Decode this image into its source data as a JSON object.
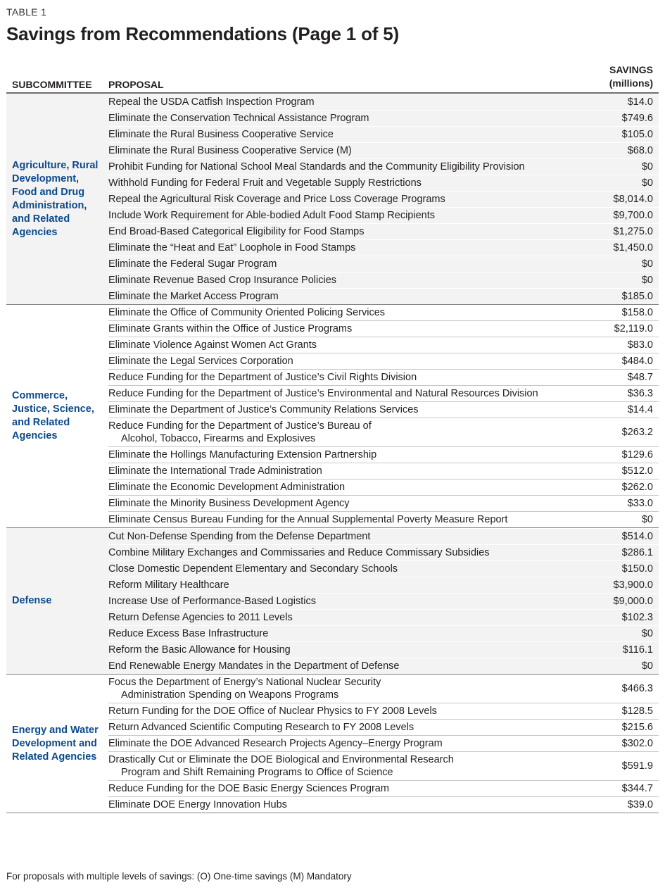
{
  "eyebrow": "TABLE 1",
  "title": "Savings from Recommendations (Page 1 of 5)",
  "columns": {
    "subcommittee": "SUBCOMMITTEE",
    "proposal": "PROPOSAL",
    "savings_line1": "SAVINGS",
    "savings_line2": "(millions)"
  },
  "colors": {
    "subcommittee_label": "#0b4a8b",
    "shaded_bg": "#f3f3f3"
  },
  "sections": [
    {
      "subcommittee": "Agriculture, Rural Development, Food and Drug Administration, and Related Agencies",
      "shaded": true,
      "rows": [
        {
          "proposal": "Repeal the USDA Catfish Inspection Program",
          "savings": "$14.0"
        },
        {
          "proposal": "Eliminate the Conservation Technical Assistance Program",
          "savings": "$749.6"
        },
        {
          "proposal": "Eliminate the Rural Business Cooperative Service",
          "savings": "$105.0"
        },
        {
          "proposal": "Eliminate the Rural Business Cooperative Service (M)",
          "savings": "$68.0"
        },
        {
          "proposal": "Prohibit Funding for National School Meal Standards and the Community Eligibility Provision",
          "savings": "$0"
        },
        {
          "proposal": "Withhold Funding for Federal Fruit and Vegetable Supply Restrictions",
          "savings": "$0"
        },
        {
          "proposal": "Repeal the Agricultural Risk Coverage and Price Loss Coverage Programs",
          "savings": "$8,014.0"
        },
        {
          "proposal": "Include Work Requirement for Able-bodied Adult Food Stamp Recipients",
          "savings": "$9,700.0"
        },
        {
          "proposal": "End Broad-Based Categorical Eligibility for Food Stamps",
          "savings": "$1,275.0"
        },
        {
          "proposal": "Eliminate the “Heat and Eat” Loophole in Food Stamps",
          "savings": "$1,450.0"
        },
        {
          "proposal": "Eliminate the Federal Sugar Program",
          "savings": "$0"
        },
        {
          "proposal": "Eliminate Revenue Based Crop Insurance Policies",
          "savings": "$0"
        },
        {
          "proposal": "Eliminate the Market Access Program",
          "savings": "$185.0"
        }
      ]
    },
    {
      "subcommittee": "Commerce, Justice, Science, and Related Agencies",
      "shaded": false,
      "rows": [
        {
          "proposal": "Eliminate the Office of Community Oriented Policing Services",
          "savings": "$158.0"
        },
        {
          "proposal": "Eliminate Grants within the Office of Justice Programs",
          "savings": "$2,119.0"
        },
        {
          "proposal": "Eliminate Violence Against Women Act Grants",
          "savings": "$83.0"
        },
        {
          "proposal": "Eliminate the Legal Services Corporation",
          "savings": "$484.0"
        },
        {
          "proposal": "Reduce Funding for the Department of Justice’s Civil Rights Division",
          "savings": "$48.7"
        },
        {
          "proposal": "Reduce Funding for the Department of Justice’s Environmental and Natural Resources Division",
          "savings": "$36.3"
        },
        {
          "proposal": "Eliminate the Department of Justice’s Community Relations Services",
          "savings": "$14.4"
        },
        {
          "proposal": "Reduce Funding for the Department of Justice’s Bureau of",
          "proposal_cont": "Alcohol, Tobacco, Firearms and Explosives",
          "savings": "$263.2"
        },
        {
          "proposal": "Eliminate the Hollings Manufacturing Extension Partnership",
          "savings": "$129.6"
        },
        {
          "proposal": "Eliminate the International Trade Administration",
          "savings": "$512.0"
        },
        {
          "proposal": "Eliminate the Economic Development Administration",
          "savings": "$262.0"
        },
        {
          "proposal": "Eliminate the Minority Business Development Agency",
          "savings": "$33.0"
        },
        {
          "proposal": "Eliminate Census Bureau Funding for the Annual Supplemental Poverty Measure Report",
          "savings": "$0"
        }
      ]
    },
    {
      "subcommittee": "Defense",
      "shaded": true,
      "rows": [
        {
          "proposal": "Cut Non-Defense Spending from the Defense Department",
          "savings": "$514.0"
        },
        {
          "proposal": "Combine Military Exchanges and Commissaries and Reduce Commissary Subsidies",
          "savings": "$286.1"
        },
        {
          "proposal": "Close Domestic Dependent Elementary and Secondary Schools",
          "savings": "$150.0"
        },
        {
          "proposal": "Reform Military Healthcare",
          "savings": "$3,900.0"
        },
        {
          "proposal": "Increase Use of Performance-Based Logistics",
          "savings": "$9,000.0"
        },
        {
          "proposal": "Return Defense Agencies to 2011 Levels",
          "savings": "$102.3"
        },
        {
          "proposal": "Reduce Excess Base Infrastructure",
          "savings": "$0"
        },
        {
          "proposal": "Reform the Basic Allowance for Housing",
          "savings": "$116.1"
        },
        {
          "proposal": "End Renewable Energy Mandates in the Department of Defense",
          "savings": "$0"
        }
      ]
    },
    {
      "subcommittee": "Energy and Water Development and Related Agencies",
      "shaded": false,
      "rows": [
        {
          "proposal": "Focus the Department of Energy’s National Nuclear Security",
          "proposal_cont": "Administration Spending on Weapons Programs",
          "savings": "$466.3"
        },
        {
          "proposal": "Return Funding for the DOE Office of Nuclear Physics to FY 2008 Levels",
          "savings": "$128.5"
        },
        {
          "proposal": "Return Advanced Scientific Computing Research to FY 2008 Levels",
          "savings": "$215.6"
        },
        {
          "proposal": "Eliminate the DOE Advanced Research Projects Agency–Energy Program",
          "savings": "$302.0"
        },
        {
          "proposal": "Drastically Cut or Eliminate the DOE Biological and Environmental Research",
          "proposal_cont": "Program and Shift Remaining Programs to Office of Science",
          "savings": "$591.9"
        },
        {
          "proposal": "Reduce Funding for the DOE Basic Energy Sciences Program",
          "savings": "$344.7"
        },
        {
          "proposal": "Eliminate DOE Energy Innovation Hubs",
          "savings": "$39.0"
        }
      ]
    }
  ],
  "footnote": "For proposals with multiple levels of savings:  (O) One-time savings  (M) Mandatory"
}
